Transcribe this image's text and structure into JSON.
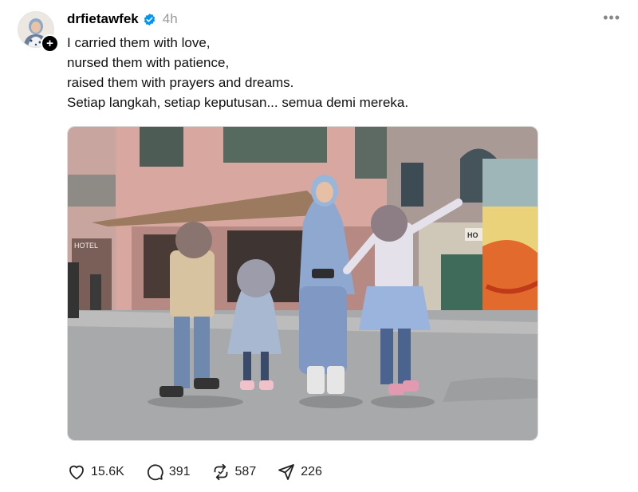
{
  "post": {
    "username": "drfietawfek",
    "time": "4h",
    "caption_lines": [
      "I carried them with love,",
      "nursed them with patience,",
      "raised them with prayers and dreams.",
      "Setiap langkah, setiap keputusan... semua demi mereka."
    ],
    "photo_signs": {
      "hotel": "HOTEL",
      "shop": "HO"
    }
  },
  "actions": {
    "likes": "15.6K",
    "replies": "391",
    "reposts": "587",
    "shares": "226"
  },
  "icons": {
    "avatar": "avatar",
    "follow": "plus-icon",
    "verified": "verified-badge-icon",
    "more": "more-icon",
    "like": "heart-icon",
    "reply": "comment-icon",
    "repost": "repost-icon",
    "share": "send-icon"
  },
  "colors": {
    "verified": "#0095f6",
    "muted": "#999999"
  }
}
